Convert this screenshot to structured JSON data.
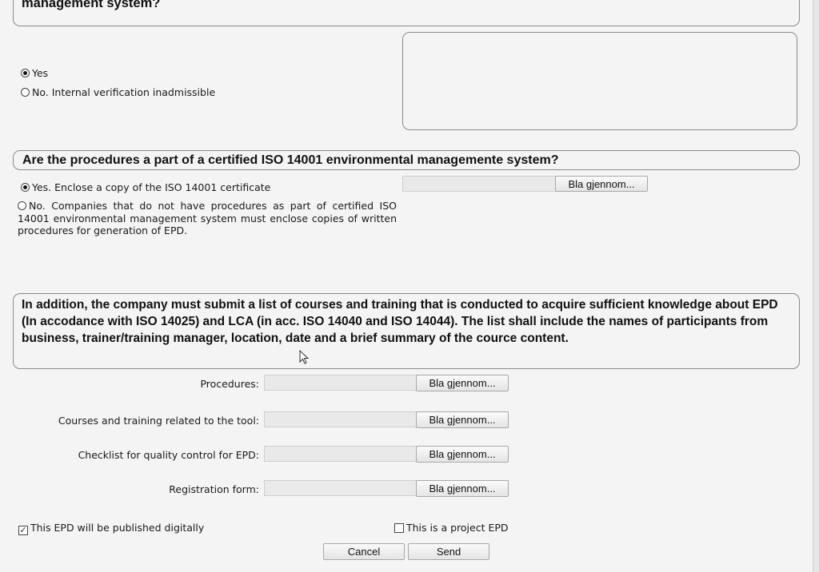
{
  "section1": {
    "title_partial": "management system?",
    "options": [
      {
        "label": "Yes",
        "selected": true
      },
      {
        "label": "No. Internal verification inadmissible",
        "selected": false
      }
    ],
    "comment_value": ""
  },
  "section2": {
    "title": "Are the procedures a part of a certified ISO 14001 environmental managemente system?",
    "options": [
      {
        "label": "Yes. Enclose a copy of the ISO 14001 certificate",
        "selected": true
      },
      {
        "label": "No. Companies that do not have procedures as part of certified ISO 14001 environmental management system must enclose copies of written procedures for generation of EPD.",
        "selected": false
      }
    ],
    "browse_label": "Bla gjennom..."
  },
  "section3": {
    "text": "In addition, the company must submit a list of courses and training that is conducted to acquire sufficient knowledge about EPD (In accodance with ISO 14025) and LCA (in acc. ISO 14040 and ISO 14044). The list shall include the names of participants from business, trainer/training manager, location, date and a brief summary of the cource content."
  },
  "uploads": [
    {
      "label": "Procedures:",
      "browse": "Bla gjennom..."
    },
    {
      "label": "Courses and training related to the tool:",
      "browse": "Bla gjennom..."
    },
    {
      "label": "Checklist for quality control for EPD:",
      "browse": "Bla gjennom..."
    },
    {
      "label": "Registration form:",
      "browse": "Bla gjennom..."
    }
  ],
  "checkboxes": {
    "digital": {
      "label": "This EPD will be published digitally",
      "checked": true
    },
    "project": {
      "label": "This is a project EPD",
      "checked": false
    }
  },
  "actions": {
    "cancel": "Cancel",
    "send": "Send"
  }
}
